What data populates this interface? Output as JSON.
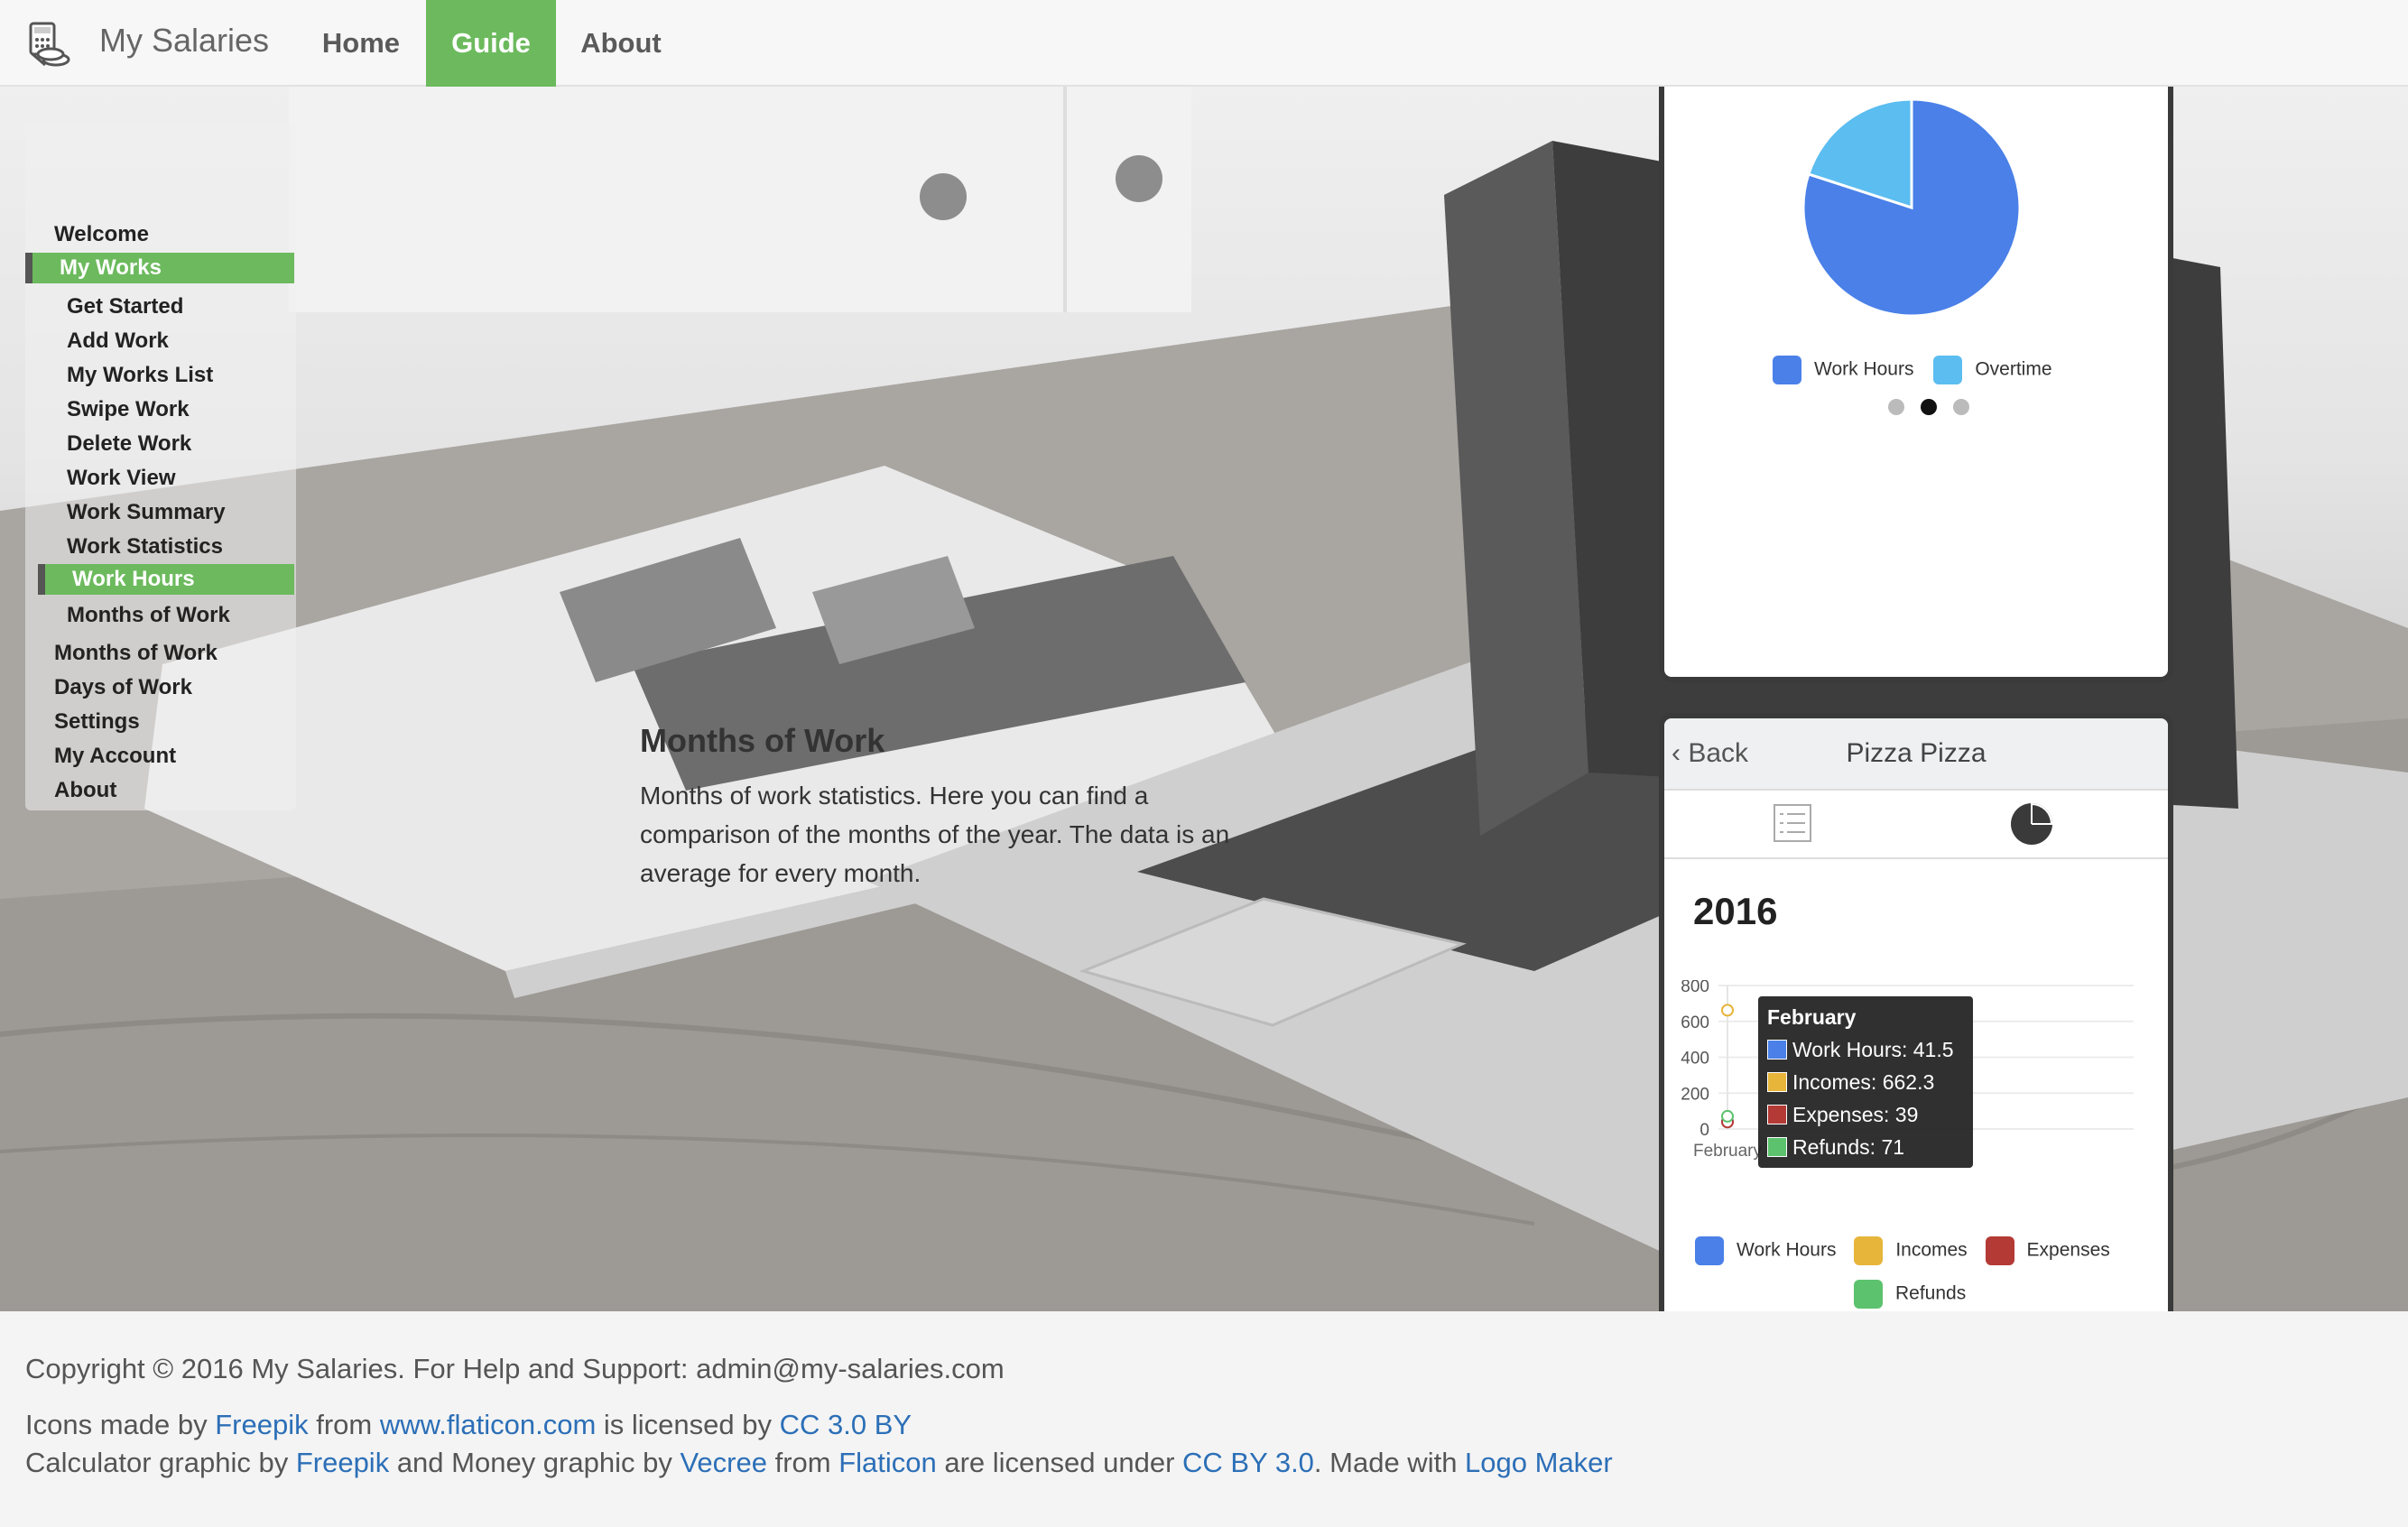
{
  "app": {
    "brand": "My Salaries",
    "logo_icon": "money-calculator-icon"
  },
  "nav": [
    {
      "label": "Home",
      "active": false
    },
    {
      "label": "Guide",
      "active": true
    },
    {
      "label": "About",
      "active": false
    }
  ],
  "sidebar": {
    "items": [
      {
        "label": "Welcome"
      },
      {
        "label": "My Works",
        "active": true
      },
      {
        "label": "Get Started"
      },
      {
        "label": "Add Work"
      },
      {
        "label": "My Works List"
      },
      {
        "label": "Swipe Work"
      },
      {
        "label": "Delete Work"
      },
      {
        "label": "Work View"
      },
      {
        "label": "Work Summary"
      },
      {
        "label": "Work Statistics"
      },
      {
        "label": "Work Hours",
        "active": true
      },
      {
        "label": "Months of Work"
      },
      {
        "label": "Months of Work"
      },
      {
        "label": "Days of Work"
      },
      {
        "label": "Settings"
      },
      {
        "label": "My Account"
      },
      {
        "label": "About"
      }
    ]
  },
  "content": {
    "title": "Months of Work",
    "text": "Months of work statistics. Here you can find a comparison of the months of the year. The data is an average for every month."
  },
  "phone1": {
    "legend": [
      {
        "label": "Work Hours",
        "color": "#4a80e8"
      },
      {
        "label": "Overtime",
        "color": "#5bbdf0"
      }
    ],
    "page_dots": {
      "count": 3,
      "active": 2
    }
  },
  "phone2": {
    "back_label": "Back",
    "title": "Pizza Pizza",
    "year": "2016",
    "tab_icons": [
      "list-icon",
      "pie-chart-icon"
    ],
    "tooltip": {
      "title": "February",
      "rows": [
        {
          "text": "Work Hours: 41.5",
          "color": "#4a80e8"
        },
        {
          "text": "Incomes: 662.3",
          "color": "#e6b53a"
        },
        {
          "text": "Expenses: 39",
          "color": "#b43a36"
        },
        {
          "text": "Refunds: 71",
          "color": "#5cc26e"
        }
      ]
    },
    "legend": [
      {
        "label": "Work Hours",
        "color": "#4a80e8"
      },
      {
        "label": "Incomes",
        "color": "#e6b53a"
      },
      {
        "label": "Expenses",
        "color": "#b43a36"
      },
      {
        "label": "Refunds",
        "color": "#5cc26e"
      }
    ]
  },
  "chart_data": [
    {
      "type": "pie",
      "categories": [
        "Work Hours",
        "Overtime"
      ],
      "values": [
        80,
        20
      ],
      "colors": [
        "#4a80e8",
        "#5bbdf0"
      ],
      "legend": "bottom"
    },
    {
      "type": "line",
      "title": "2016",
      "categories": [
        "February"
      ],
      "series": [
        {
          "name": "Work Hours",
          "values": [
            41.5
          ],
          "color": "#4a80e8"
        },
        {
          "name": "Incomes",
          "values": [
            662.3
          ],
          "color": "#e6b53a"
        },
        {
          "name": "Expenses",
          "values": [
            39
          ],
          "color": "#b43a36"
        },
        {
          "name": "Refunds",
          "values": [
            71
          ],
          "color": "#5cc26e"
        }
      ],
      "y_ticks": [
        "800",
        "600",
        "400",
        "200",
        "0"
      ],
      "ylim": [
        0,
        800
      ],
      "grid": true,
      "legend": "bottom"
    }
  ],
  "footer": {
    "copyright": "Copyright © 2016 My Salaries. For Help and Support: admin@my-salaries.com",
    "line2": {
      "t1": "Icons made by ",
      "l1": "Freepik",
      "t2": " from ",
      "l2": "www.flaticon.com",
      "t3": " is licensed by ",
      "l3": "CC 3.0 BY"
    },
    "line3": {
      "t1": "Calculator graphic by ",
      "l1": "Freepik",
      "t2": " and Money graphic by ",
      "l2": "Vecree",
      "t3": " from ",
      "l3": "Flaticon",
      "t4": " are licensed under ",
      "l4": "CC BY 3.0",
      "t5": ". Made with ",
      "l5": "Logo Maker"
    }
  }
}
